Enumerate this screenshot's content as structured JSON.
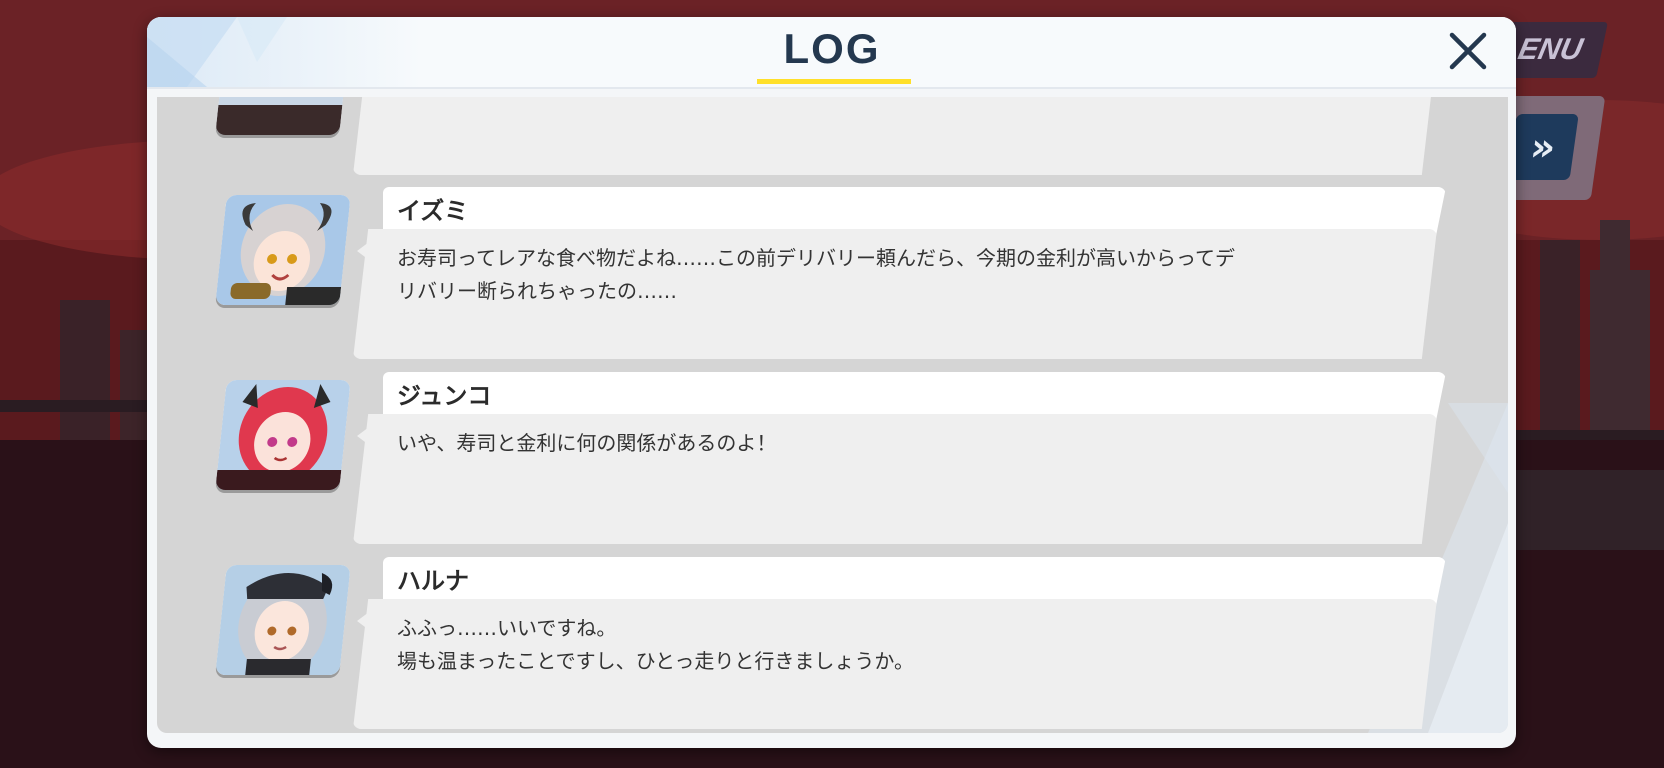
{
  "background": {
    "menu_label": "ENU",
    "skip_label": "»"
  },
  "log": {
    "title": "LOG",
    "close_icon": "close-icon",
    "accent_color": "#ffe02a",
    "entries": [
      {
        "name": "イズミ",
        "text": "お寿司ってレアな食べ物だよね……この前デリバリー頼んだら、今期の金利が高いからってデ\nリバリー断られちゃったの……"
      },
      {
        "name": "ジュンコ",
        "text": "いや、寿司と金利に何の関係があるのよ！"
      },
      {
        "name": "ハルナ",
        "text": "ふふっ……いいですね。\n場も温まったことですし、ひとっ走りと行きましょうか。"
      }
    ]
  }
}
